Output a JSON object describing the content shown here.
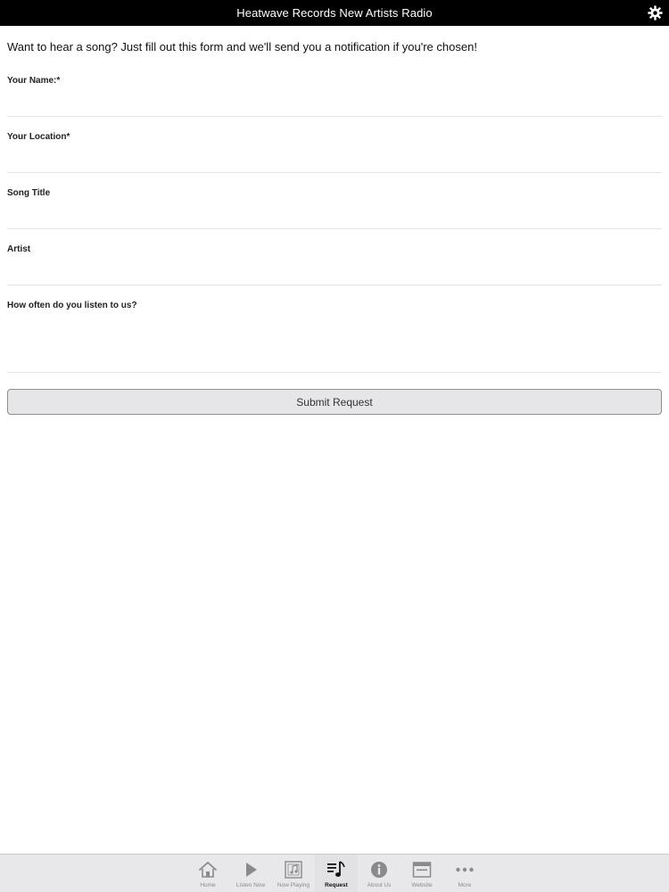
{
  "header": {
    "title": "Heatwave Records New Artists Radio",
    "settings_icon": "gear-icon"
  },
  "form": {
    "intro": "Want to hear a song? Just fill out this form and we'll send you a notification if you're chosen!",
    "fields": [
      {
        "label": "Your Name:*",
        "value": "",
        "placeholder": ""
      },
      {
        "label": "Your Location*",
        "value": "",
        "placeholder": ""
      },
      {
        "label": "Song Title",
        "value": "",
        "placeholder": ""
      },
      {
        "label": "Artist",
        "value": "",
        "placeholder": ""
      },
      {
        "label": "How often do you listen to us?",
        "value": "",
        "placeholder": ""
      }
    ],
    "submit_label": "Submit Request"
  },
  "tabbar": {
    "items": [
      {
        "label": "Home",
        "icon": "home-icon",
        "active": false
      },
      {
        "label": "Listen Now",
        "icon": "play-icon",
        "active": false
      },
      {
        "label": "Now Playing",
        "icon": "music-note-icon",
        "active": false
      },
      {
        "label": "Request",
        "icon": "playlist-icon",
        "active": true
      },
      {
        "label": "About Us",
        "icon": "info-icon",
        "active": false
      },
      {
        "label": "Website",
        "icon": "browser-icon",
        "active": false
      },
      {
        "label": "More",
        "icon": "more-icon",
        "active": false
      }
    ]
  },
  "colors": {
    "header_bg": "#000000",
    "button_bg": "#e6e5e8",
    "tabbar_bg": "#e8e7ea",
    "icon_inactive": "#8a8a8d",
    "icon_active": "#111111"
  }
}
